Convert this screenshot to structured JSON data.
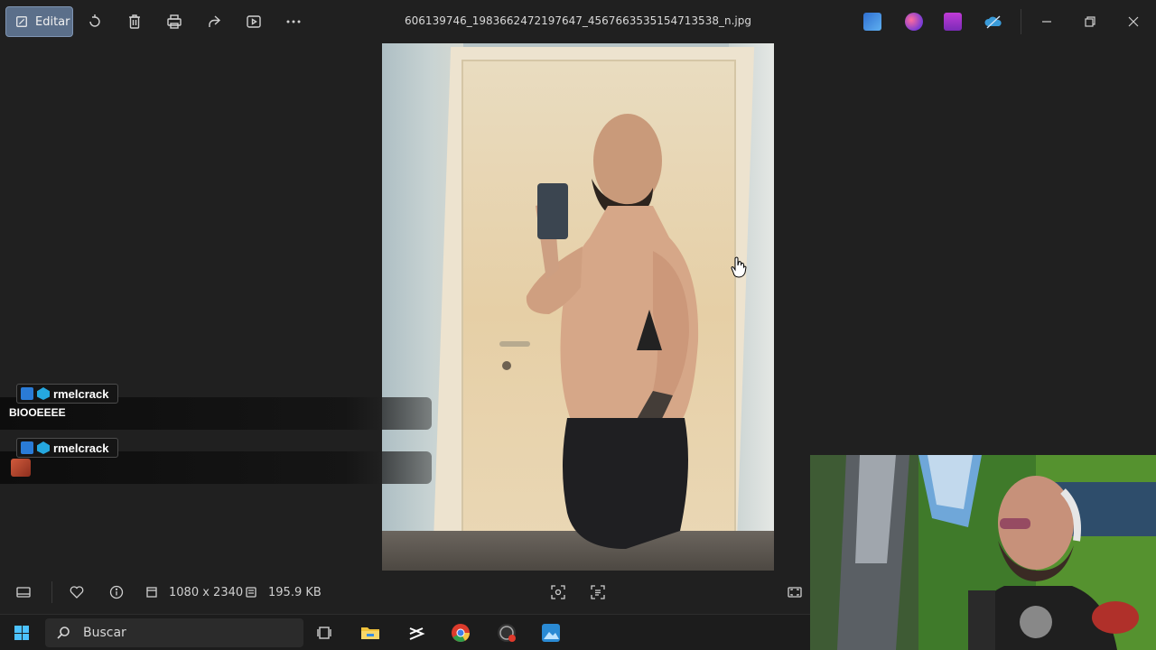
{
  "toolbar": {
    "edit_label": "Editar",
    "filename": "606139746_1983662472197647_4567663535154713538_n.jpg",
    "icons": [
      "edit-icon",
      "rotate-icon",
      "delete-icon",
      "print-icon",
      "share-icon",
      "slideshow-icon",
      "more-icon"
    ],
    "apps": [
      "photos-designer-icon",
      "clipchamp-icon",
      "video-editor-icon",
      "onedrive-icon"
    ]
  },
  "chat": {
    "messages": [
      {
        "user": "rmelcrack",
        "text": "BIOOEEEE"
      },
      {
        "user": "rmelcrack",
        "text": "",
        "emote": "emote"
      }
    ]
  },
  "statusbar": {
    "dimensions": "1080 x 2340",
    "size": "195.9 KB"
  },
  "taskbar": {
    "search_placeholder": "Buscar"
  },
  "colors": {
    "accent": "#5b6f8a",
    "background": "#202020",
    "windows_blue": "#4cc2ff"
  }
}
